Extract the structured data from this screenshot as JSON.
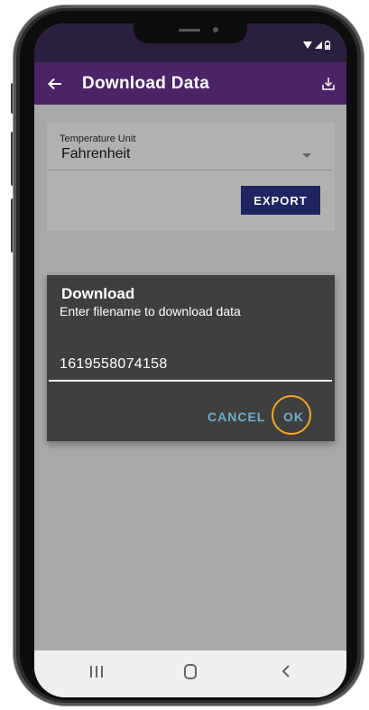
{
  "app_bar": {
    "title": "Download Data",
    "back_icon": "arrow-left-icon",
    "download_icon": "download-icon",
    "color": "#4b2468"
  },
  "status_bar": {
    "icons": [
      "wifi-icon",
      "signal-icon",
      "battery-icon"
    ]
  },
  "settings_card": {
    "temperature_label": "Temperature Unit",
    "temperature_value": "Fahrenheit",
    "export_label": "EXPORT"
  },
  "dialog": {
    "title": "Download",
    "message": "Enter filename to download data",
    "filename_value": "1619558074158",
    "cancel_label": "CANCEL",
    "ok_label": "OK",
    "button_color": "#6cb0cb",
    "highlight_color": "#f5a623"
  },
  "nav_bar": {
    "icons": [
      "recents-icon",
      "home-icon",
      "back-icon"
    ]
  }
}
